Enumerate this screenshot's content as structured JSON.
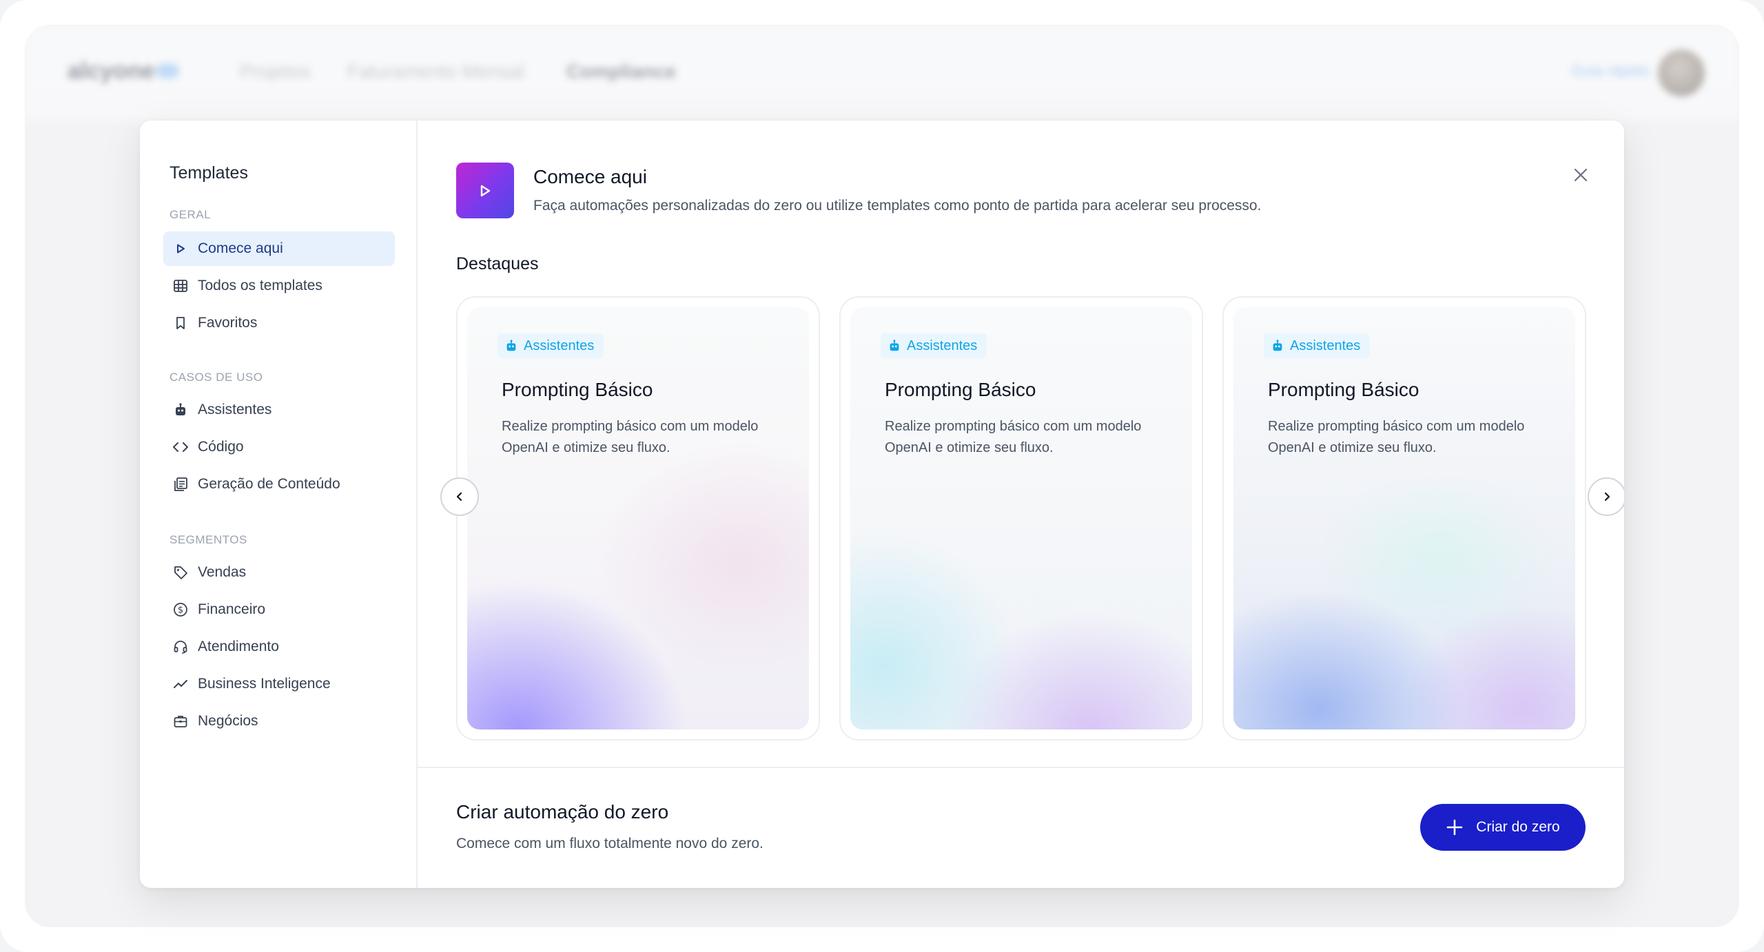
{
  "background": {
    "brand": "alcyone",
    "breadcrumbs": [
      "Projetos",
      "Faturamento Mensal",
      "Compliance"
    ],
    "helper": "Guia rápido"
  },
  "sidebar": {
    "title": "Templates",
    "sections": {
      "geral": "GERAL",
      "casos": "CASOS DE USO",
      "segmentos": "SEGMENTOS"
    },
    "items": {
      "comece": "Comece aqui",
      "todos": "Todos os templates",
      "favoritos": "Favoritos",
      "assistentes": "Assistentes",
      "codigo": "Código",
      "geracao": "Geração de Conteúdo",
      "vendas": "Vendas",
      "financeiro": "Financeiro",
      "atendimento": "Atendimento",
      "bi": "Business Inteligence",
      "negocios": "Negócios"
    }
  },
  "header": {
    "title": "Comece aqui",
    "subtitle": "Faça automações personalizadas do zero ou utilize templates como ponto de partida para acelerar seu processo."
  },
  "highlights": {
    "title": "Destaques",
    "cards": [
      {
        "badge": "Assistentes",
        "title": "Prompting Básico",
        "desc": "Realize prompting básico com um modelo OpenAI e otimize seu fluxo."
      },
      {
        "badge": "Assistentes",
        "title": "Prompting Básico",
        "desc": "Realize prompting básico com um modelo OpenAI e otimize seu fluxo."
      },
      {
        "badge": "Assistentes",
        "title": "Prompting Básico",
        "desc": "Realize prompting básico com um modelo OpenAI e otimize seu fluxo."
      }
    ]
  },
  "footer": {
    "title": "Criar automação do zero",
    "subtitle": "Comece com um fluxo totalmente novo do zero.",
    "button": "Criar do zero"
  },
  "colors": {
    "accent": "#1a1fc9",
    "active_bg": "#e7f0fd",
    "badge_text": "#0ea5e9",
    "badge_bg": "#eaf6fd"
  },
  "icons": {
    "hero": "play-icon",
    "close": "close-icon",
    "badge": "robot-icon",
    "prev": "chevron-left-icon",
    "next": "chevron-right-icon",
    "create": "plus-icon"
  }
}
